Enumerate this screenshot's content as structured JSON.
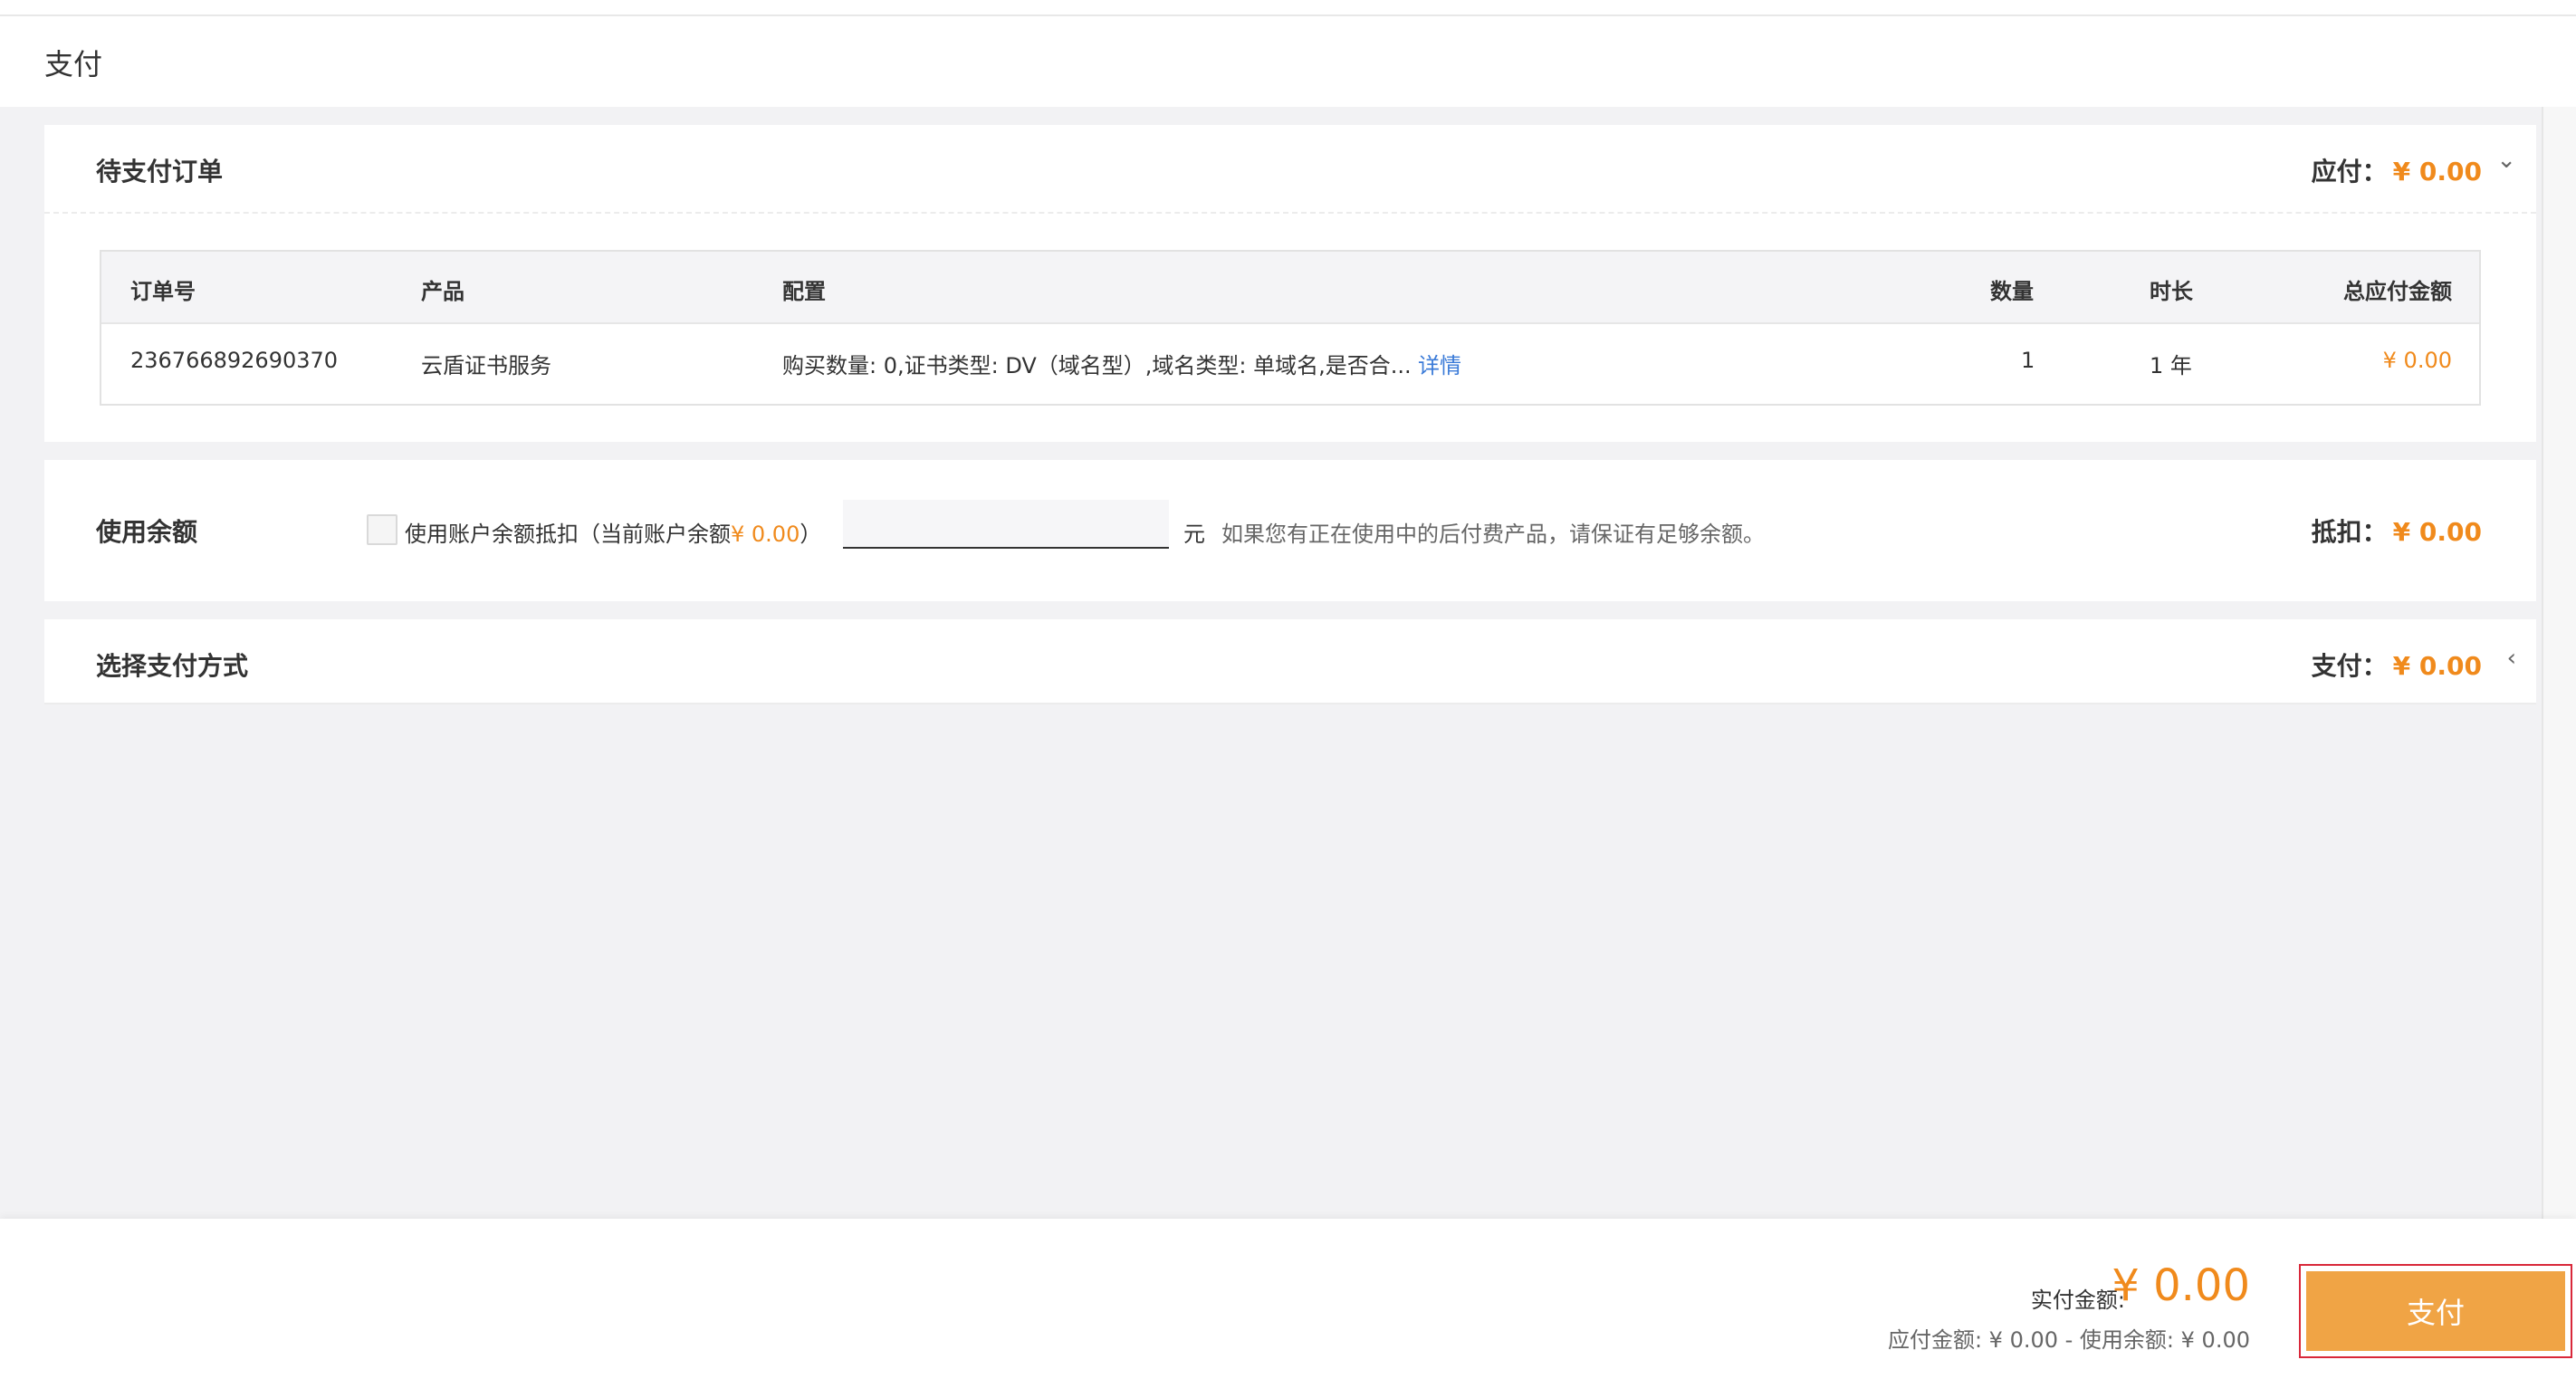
{
  "header": {
    "title": "支付"
  },
  "orders": {
    "title": "待支付订单",
    "amount_label": "应付：",
    "amount_value": "¥ 0.00",
    "collapse_icon": "chevron-down-icon",
    "columns": [
      "订单号",
      "产品",
      "配置",
      "数量",
      "时长",
      "总应付金额"
    ],
    "rows": [
      {
        "order_no": "236766892690370",
        "product": "云盾证书服务",
        "config": "购买数量: 0,证书类型: DV（域名型）,域名类型: 单域名,是否合...",
        "detail_link": "详情",
        "quantity": "1",
        "duration": "1 年",
        "total": "¥ 0.00"
      }
    ]
  },
  "balance": {
    "title": "使用余额",
    "checkbox_label_prefix": "使用账户余额抵扣（当前账户余额",
    "current_balance": "¥ 0.00",
    "checkbox_label_suffix": "）",
    "input_value": "",
    "unit": "元",
    "notice": "如果您有正在使用中的后付费产品，请保证有足够余额。",
    "deduct_label": "抵扣：",
    "deduct_value": "¥ 0.00"
  },
  "method": {
    "title": "选择支付方式",
    "pay_label": "支付：",
    "pay_value": "¥ 0.00",
    "expand_icon": "chevron-left-icon"
  },
  "footer": {
    "actual_label": "实付金额:",
    "actual_value": "¥ 0.00",
    "breakdown": "应付金额: ¥ 0.00 - 使用余额: ¥ 0.00",
    "pay_button": "支付"
  },
  "colors": {
    "accent": "#f08a1c",
    "pay_button": "#f0a445",
    "link": "#3b7bd8",
    "highlight_border": "#d9283a"
  }
}
